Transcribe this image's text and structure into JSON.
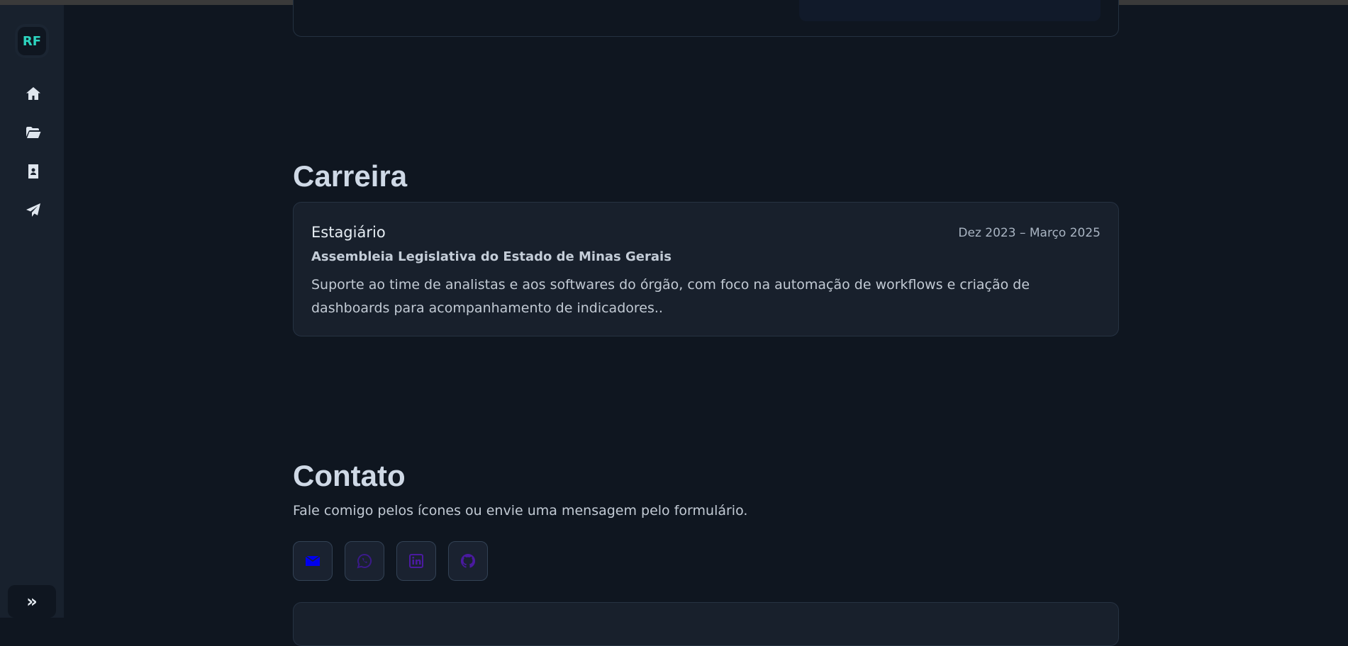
{
  "sidebar": {
    "logo": "RF",
    "items": [
      {
        "icon": "home-icon"
      },
      {
        "icon": "folder-open-icon"
      },
      {
        "icon": "contact-card-icon"
      },
      {
        "icon": "paper-plane-icon"
      }
    ],
    "expand_label": "»"
  },
  "career": {
    "title": "Carreira",
    "role": "Estagiário",
    "dates": "Dez 2023 – Março 2025",
    "org": "Assembleia Legislativa do Estado de Minas Gerais",
    "description": "Suporte ao time de analistas e aos softwares do órgão, com foco na automação de workflows e criação de dashboards para acompanhamento de indicadores.."
  },
  "contact": {
    "title": "Contato",
    "subtitle": "Fale comigo pelos ícones ou envie uma mensagem pelo formulário.",
    "icons": [
      {
        "icon": "envelope-icon",
        "color": "#0000ee"
      },
      {
        "icon": "whatsapp-icon",
        "color": "#3b1a8a"
      },
      {
        "icon": "linkedin-icon",
        "color": "#4a1aa0"
      },
      {
        "icon": "github-icon",
        "color": "#4a1aa0"
      }
    ]
  }
}
